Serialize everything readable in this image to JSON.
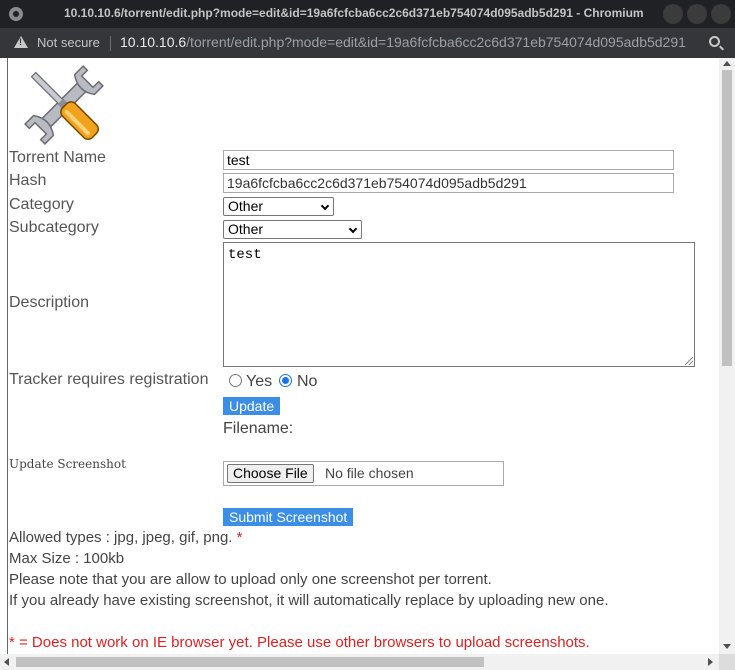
{
  "window": {
    "title": "10.10.10.6/torrent/edit.php?mode=edit&id=19a6fcfcba6cc2c6d371eb754074d095adb5d291 - Chromium"
  },
  "addressbar": {
    "security_label": "Not secure",
    "url_host": "10.10.10.6",
    "url_path": "/torrent/edit.php?mode=edit&id=19a6fcfcba6cc2c6d371eb754074d095adb5d291"
  },
  "form": {
    "torrent_name": {
      "label": "Torrent Name",
      "value": "test"
    },
    "hash": {
      "label": "Hash",
      "value": "19a6fcfcba6cc2c6d371eb754074d095adb5d291"
    },
    "category": {
      "label": "Category",
      "value": "Other"
    },
    "subcategory": {
      "label": "Subcategory",
      "value": "Other"
    },
    "description": {
      "label": "Description",
      "value": "test"
    },
    "tracker": {
      "label": "Tracker requires registration",
      "yes_label": "Yes",
      "no_label": "No",
      "selected": "No"
    },
    "update_button": "Update",
    "filename_label": "Filename:"
  },
  "screenshot": {
    "label": "Update Screenshot",
    "choose_file_button": "Choose File",
    "file_status": "No file chosen",
    "submit_button": "Submit Screenshot",
    "allowed_types": "Allowed types : jpg, jpeg, gif, png.",
    "asterisk": "*",
    "max_size": "Max Size : 100kb",
    "note_one": "Please note that you are allow to upload only one screenshot per torrent.",
    "note_two": "If you already have existing screenshot, it will automatically replace by uploading new one.",
    "ie_warning": "* = Does not work on IE browser yet. Please use other browsers to upload screenshots."
  },
  "colors": {
    "button_blue": "#3b8ee6",
    "warning_red": "#e02020",
    "radio_accent": "#1a73e8"
  },
  "icons": [
    "chromium-icon",
    "warning-icon",
    "zoom-icon",
    "tools-icon"
  ]
}
